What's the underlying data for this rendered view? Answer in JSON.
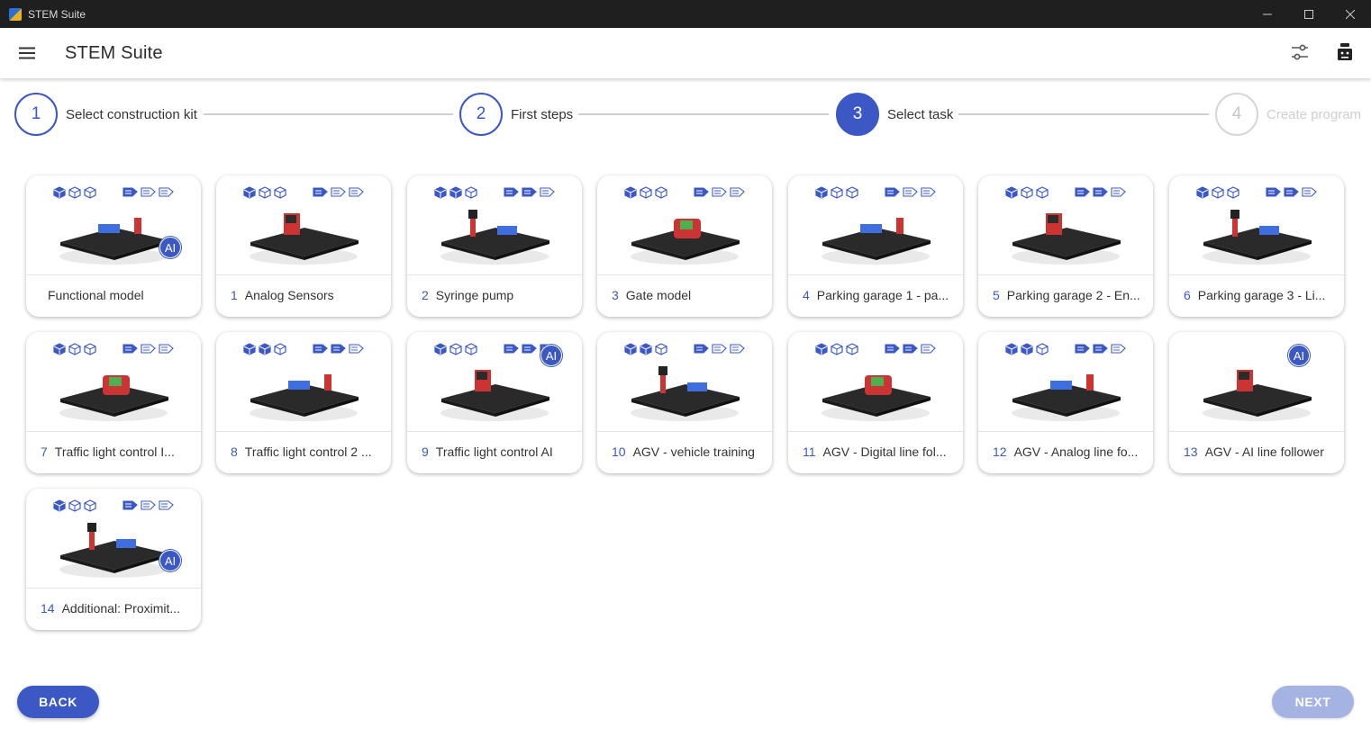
{
  "window": {
    "title": "STEM Suite",
    "icon": "stem-suite-icon"
  },
  "appbar": {
    "title": "STEM Suite",
    "menu_icon": "hamburger-menu-icon",
    "settings_icon": "sliders-icon",
    "device_icon": "controller-device-icon"
  },
  "stepper": {
    "steps": [
      {
        "number": "1",
        "label": "Select construction kit",
        "state": "completed"
      },
      {
        "number": "2",
        "label": "First steps",
        "state": "completed"
      },
      {
        "number": "3",
        "label": "Select task",
        "state": "active"
      },
      {
        "number": "4",
        "label": "Create program",
        "state": "disabled"
      }
    ]
  },
  "tasks": [
    {
      "number": "",
      "title": "Functional model",
      "ai": true,
      "cubes_filled": 1,
      "pages_filled": 1
    },
    {
      "number": "1",
      "title": "Analog Sensors",
      "ai": false,
      "cubes_filled": 1,
      "pages_filled": 1
    },
    {
      "number": "2",
      "title": "Syringe pump",
      "ai": false,
      "cubes_filled": 2,
      "pages_filled": 2
    },
    {
      "number": "3",
      "title": "Gate model",
      "ai": false,
      "cubes_filled": 1,
      "pages_filled": 1
    },
    {
      "number": "4",
      "title": "Parking garage 1 - pa...",
      "ai": false,
      "cubes_filled": 1,
      "pages_filled": 1
    },
    {
      "number": "5",
      "title": "Parking garage 2 - En...",
      "ai": false,
      "cubes_filled": 1,
      "pages_filled": 2
    },
    {
      "number": "6",
      "title": "Parking garage 3 - Li...",
      "ai": false,
      "cubes_filled": 1,
      "pages_filled": 2
    },
    {
      "number": "7",
      "title": "Traffic light control I...",
      "ai": false,
      "cubes_filled": 1,
      "pages_filled": 1
    },
    {
      "number": "8",
      "title": "Traffic light control 2 ...",
      "ai": false,
      "cubes_filled": 2,
      "pages_filled": 2
    },
    {
      "number": "9",
      "title": "Traffic light control AI",
      "ai": true,
      "cubes_filled": 1,
      "pages_filled": 3
    },
    {
      "number": "10",
      "title": "AGV - vehicle training",
      "ai": false,
      "cubes_filled": 2,
      "pages_filled": 1
    },
    {
      "number": "11",
      "title": "AGV - Digital line fol...",
      "ai": false,
      "cubes_filled": 1,
      "pages_filled": 2
    },
    {
      "number": "12",
      "title": "AGV - Analog line fo...",
      "ai": false,
      "cubes_filled": 2,
      "pages_filled": 2
    },
    {
      "number": "13",
      "title": "AGV - AI line follower",
      "ai": true,
      "cubes_filled": 0,
      "pages_filled": 0
    },
    {
      "number": "14",
      "title": "Additional: Proximit...",
      "ai": true,
      "cubes_filled": 1,
      "pages_filled": 1
    }
  ],
  "ai_badge_text": "AI",
  "footer": {
    "back_label": "BACK",
    "next_label": "NEXT"
  },
  "colors": {
    "accent": "#3b58c4",
    "accent_disabled": "#a5b3e3",
    "titlebar": "#1f1f1f"
  }
}
